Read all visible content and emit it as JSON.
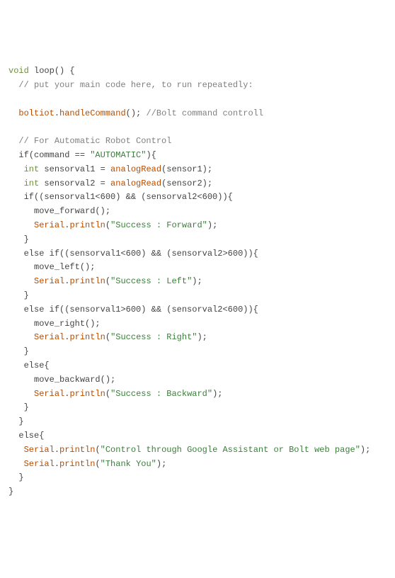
{
  "code": {
    "l01_type": "void",
    "l01_fn": "loop",
    "l01_rest": "() {",
    "l02_comment": "// put your main code here, to run repeatedly:",
    "l04_obj": "boltiot",
    "l04_dot": ".",
    "l04_method": "handleCommand",
    "l04_call": "();",
    "l04_comment": " //Bolt command controll",
    "l06_comment": "// For Automatic Robot Control",
    "l07_if": "if",
    "l07_cond1": "(command == ",
    "l07_str": "\"AUTOMATIC\"",
    "l07_cond2": "){",
    "l08_type": "int",
    "l08_var": " sensorval1 = ",
    "l08_fn": "analogRead",
    "l08_arg": "(sensor1);",
    "l09_type": "int",
    "l09_var": " sensorval2 = ",
    "l09_fn": "analogRead",
    "l09_arg": "(sensor2);",
    "l10_if": "if",
    "l10_cond": "((sensorval1<600) && (sensorval2<600)){",
    "l11_stmt": "move_forward();",
    "l12_obj": "Serial",
    "l12_dot": ".",
    "l12_method": "println",
    "l12_open": "(",
    "l12_str": "\"Success : Forward\"",
    "l12_close": ");",
    "l13_brace": "}",
    "l14_else": "else if",
    "l14_cond": "((sensorval1<600) && (sensorval2>600)){",
    "l15_stmt": "move_left();",
    "l16_obj": "Serial",
    "l16_dot": ".",
    "l16_method": "println",
    "l16_open": "(",
    "l16_str": "\"Success : Left\"",
    "l16_close": ");",
    "l17_brace": "}",
    "l18_else": "else if",
    "l18_cond": "((sensorval1>600) && (sensorval2<600)){",
    "l19_stmt": "move_right();",
    "l20_obj": "Serial",
    "l20_dot": ".",
    "l20_method": "println",
    "l20_open": "(",
    "l20_str": "\"Success : Right\"",
    "l20_close": ");",
    "l21_brace": "}",
    "l22_else": "else",
    "l22_brace": "{",
    "l23_stmt": "move_backward();",
    "l24_obj": "Serial",
    "l24_dot": ".",
    "l24_method": "println",
    "l24_open": "(",
    "l24_str": "\"Success : Backward\"",
    "l24_close": ");",
    "l25_brace": "}",
    "l26_brace": "}",
    "l27_else": "else",
    "l27_brace": "{",
    "l28_obj": "Serial",
    "l28_dot": ".",
    "l28_method": "println",
    "l28_open": "(",
    "l28_str": "\"Control through Google Assistant or Bolt web page\"",
    "l28_close": ");",
    "l29_obj": "Serial",
    "l29_dot": ".",
    "l29_method": "println",
    "l29_open": "(",
    "l29_str": "\"Thank You\"",
    "l29_close": ");",
    "l30_brace": "}",
    "l31_brace": "}"
  }
}
